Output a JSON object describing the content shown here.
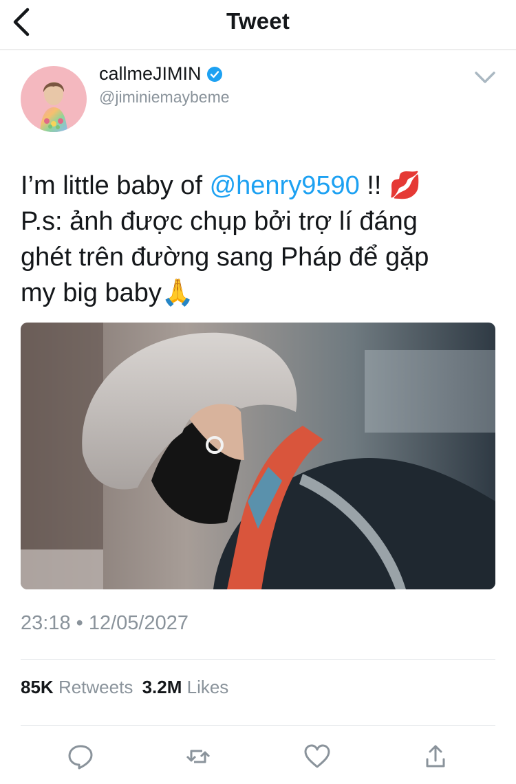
{
  "header": {
    "title": "Tweet"
  },
  "user": {
    "display_name": "callmeJIMIN",
    "handle": "@jiminiemaybeme",
    "verified": true
  },
  "tweet": {
    "line1_prefix": "I’m little baby of ",
    "mention": "@henry9590",
    "line1_suffix": " !! ",
    "line1_emoji": "💋",
    "line2": "P.s: ảnh được chụp bởi trợ lí đáng",
    "line3": "ghét trên đường sang Pháp để gặp",
    "line4": "my big baby",
    "line4_emoji": "🙏"
  },
  "meta": {
    "timestamp": "23:18 • 12/05/2027"
  },
  "stats": {
    "retweets_count": "85K",
    "retweets_label": "Retweets",
    "likes_count": "3.2M",
    "likes_label": "Likes"
  },
  "actions": [
    "reply-icon",
    "retweet-icon",
    "like-icon",
    "share-icon"
  ],
  "colors": {
    "accent": "#1da1f2",
    "secondary_text": "#8a939b",
    "primary_text": "#14171a"
  }
}
